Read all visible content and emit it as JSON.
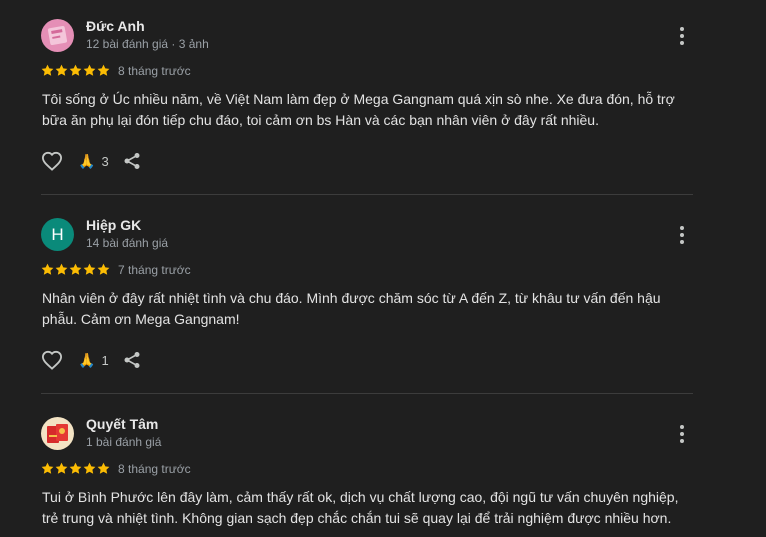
{
  "colors": {
    "background": "#1f1f1f",
    "star": "#fbbc04",
    "secondary_text": "#9aa0a6",
    "avatar_h": "#0a8a7a"
  },
  "reviews": [
    {
      "name": "Đức Anh",
      "meta": "12 bài đánh giá · 3 ảnh",
      "rating": 5,
      "time": "8 tháng trước",
      "text": "Tôi sống ở Úc nhiều năm, về Việt Nam làm đẹp ở Mega Gangnam quá xịn sò nhe. Xe đưa đón, hỗ trợ bữa ăn phụ lại đón tiếp chu đáo, toi cảm ơn bs Hàn và các bạn nhân viên ở đây rất nhiều.",
      "reaction_count": "3",
      "avatar_icon": "photo-avatar-pink"
    },
    {
      "name": "Hiệp GK",
      "meta": "14 bài đánh giá",
      "rating": 5,
      "time": "7 tháng trước",
      "text": "Nhân viên ở đây rất nhiệt tình và chu đáo. Mình được chăm sóc từ A đến Z, từ khâu tư vấn đến hậu phẫu. Cảm ơn Mega Gangnam!",
      "reaction_count": "1",
      "avatar_letter": "H"
    },
    {
      "name": "Quyết Tâm",
      "meta": "1 bài đánh giá",
      "rating": 5,
      "time": "8 tháng trước",
      "text": "Tui ở Bình Phước lên đây làm, cảm thấy rất ok, dịch vụ chất lượng cao, đội ngũ tư vấn chuyên nghiệp, trẻ trung và nhiệt tình. Không gian sạch đẹp chắc chắn tui sẽ quay lại để trải nghiệm được nhiều hơn.",
      "avatar_icon": "photo-avatar-red"
    }
  ]
}
